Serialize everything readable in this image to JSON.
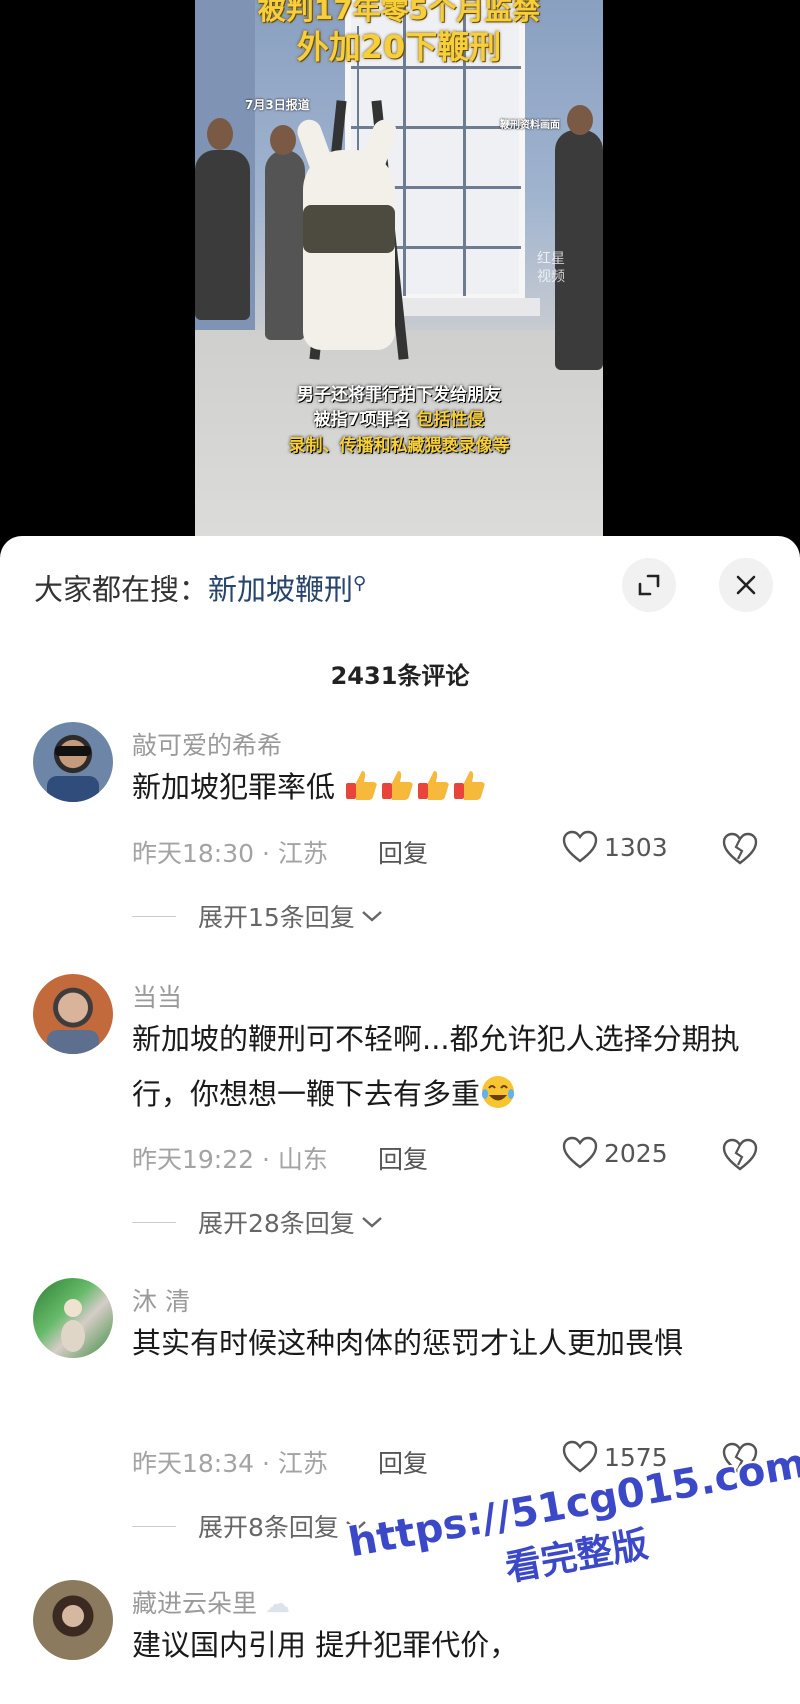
{
  "video": {
    "title_line1": "被判17年零5个月监禁",
    "title_line2": "外加20下鞭刑",
    "date_label": "7月3日报道",
    "tag_label": "鞭刑资料画面",
    "logo_text": "红星视频",
    "subtitle_line1": "男子还将罪行拍下发给朋友",
    "subtitle_line2_a": "被指7项罪名",
    "subtitle_line2_b": "包括性侵",
    "subtitle_line3": "录制、传播和私藏猥亵录像等"
  },
  "search": {
    "prefix": "大家都在搜：",
    "keyword": "新加坡鞭刑"
  },
  "comments_count": "2431条评论",
  "comments": [
    {
      "username": "敲可爱的希希",
      "text": "新加坡犯罪率低",
      "meta": "昨天18:30 · 江苏",
      "reply_label": "回复",
      "likes": "1303",
      "expand_label": "展开15条回复"
    },
    {
      "username": "当当",
      "text": "新加坡的鞭刑可不轻啊...都允许犯人选择分期执行，你想想一鞭下去有多重",
      "meta": "昨天19:22 · 山东",
      "reply_label": "回复",
      "likes": "2025",
      "expand_label": "展开28条回复"
    },
    {
      "username": "沐 清",
      "text": "其实有时候这种肉体的惩罚才让人更加畏惧",
      "meta": "昨天18:34 · 江苏",
      "reply_label": "回复",
      "likes": "1575",
      "expand_label": "展开8条回复"
    },
    {
      "username": "藏进云朵里",
      "text": "建议国内引用  提升犯罪代价，",
      "meta": "",
      "reply_label": "",
      "likes": "",
      "expand_label": ""
    }
  ],
  "watermark": {
    "line1": "https://51cg015.com",
    "line2": "看完整版"
  },
  "colors": {
    "accent_keyword": "#27456e",
    "video_title_yellow": "#f6cf3a",
    "watermark_blue": "#3b48c8"
  }
}
